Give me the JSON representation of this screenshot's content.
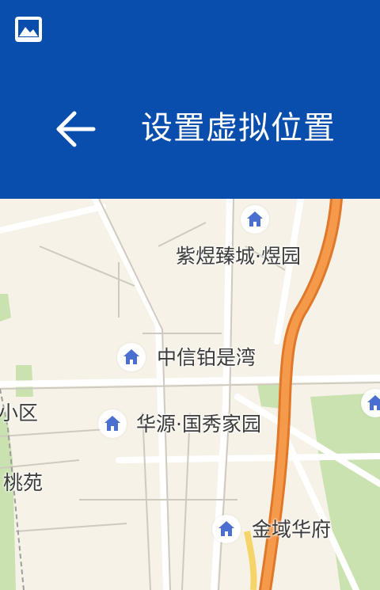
{
  "header": {
    "title": "设置虚拟位置",
    "background_color": "#0a4ead",
    "status_icon": "image-icon",
    "back_icon": "arrow-left-icon"
  },
  "map": {
    "pois": [
      {
        "icon": "home-icon",
        "label": "紫煜臻城·煜园"
      },
      {
        "icon": "home-icon",
        "label": "中信铂是湾"
      },
      {
        "icon": "home-icon",
        "label": "华源·国秀家园"
      },
      {
        "icon": "home-icon",
        "label": "金域华府"
      },
      {
        "icon": "home-icon",
        "label": ""
      }
    ],
    "partial_labels": [
      "小区",
      "桃苑"
    ],
    "colors": {
      "highway": "#f08a3a",
      "green_area": "#c9e2b0",
      "road": "#ffffff",
      "poi_icon": "#4a6fd0"
    }
  }
}
